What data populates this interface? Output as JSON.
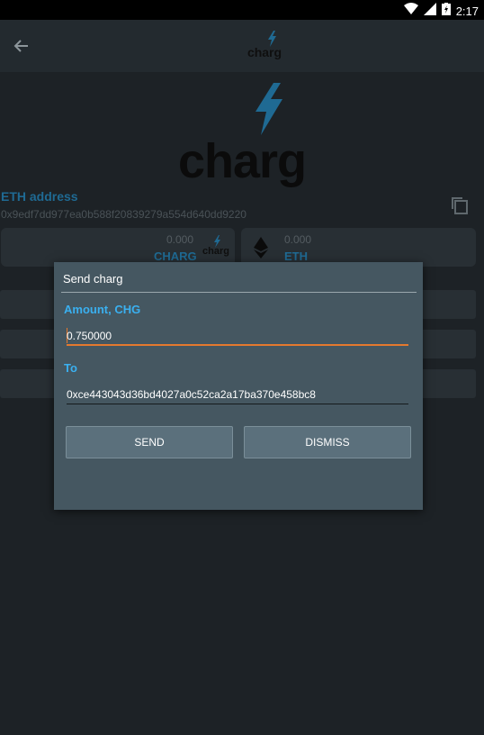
{
  "status_bar": {
    "time": "2:17"
  },
  "app_bar": {
    "logo_text": "charg"
  },
  "hero": {
    "logo_text": "charg"
  },
  "wallet": {
    "eth_address_label": "ETH address",
    "eth_address": "0x9edf7dd977ea0b588f20839279a554d640dd9220"
  },
  "balances": [
    {
      "amount": "0.000",
      "currency": "CHARG",
      "icon_text": "charg"
    },
    {
      "amount": "0.000",
      "currency": "ETH"
    }
  ],
  "dialog": {
    "title": "Send charg",
    "amount_label": "Amount, CHG",
    "amount_value": "0.750000",
    "to_label": "To",
    "to_value": "0xce443043d36bd4027a0c52ca2a17ba370e458bc8",
    "send_label": "SEND",
    "dismiss_label": "DISMISS"
  },
  "colors": {
    "accent_blue": "#3ab0f0",
    "focus_orange": "#e4792e",
    "dialog_bg": "#455761"
  }
}
